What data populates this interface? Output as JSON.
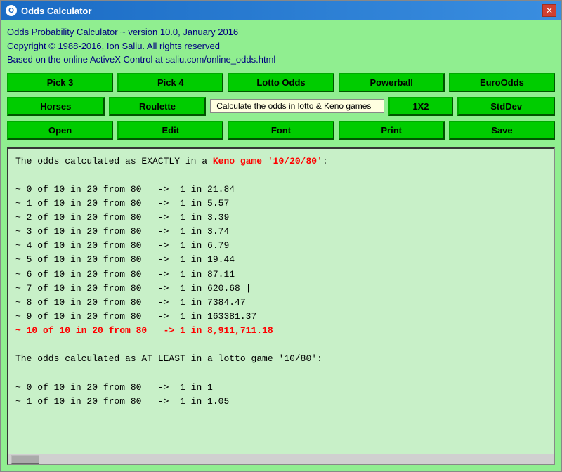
{
  "window": {
    "title": "Odds Calculator",
    "icon": "O"
  },
  "header": {
    "line1": "Odds Probability Calculator ~ version 10.0, January 2016",
    "line2": "Copyright © 1988-2016, Ion Saliu. All rights reserved",
    "line3": "Based on the online ActiveX Control at saliu.com/online_odds.html"
  },
  "buttons_row1": {
    "btn1": "Pick 3",
    "btn2": "Pick 4",
    "btn3": "Lotto Odds",
    "btn4": "Powerball",
    "btn5": "EuroOdds"
  },
  "buttons_row2": {
    "btn1": "Horses",
    "btn2": "Roulette",
    "tooltip": "Calculate the odds in lotto & Keno games",
    "btn3": "1X2",
    "btn4": "StdDev"
  },
  "buttons_row3": {
    "btn1": "Open",
    "btn2": "Edit",
    "btn3": "Font",
    "btn4": "Print",
    "btn5": "Save"
  },
  "output": {
    "lines": [
      {
        "text": "The odds calculated as EXACTLY in a ",
        "type": "normal"
      },
      {
        "text": "Keno game '10/20/80':",
        "type": "red-inline",
        "prefix": "The odds calculated as EXACTLY in a "
      },
      {
        "text": "",
        "type": "blank"
      },
      {
        "text": "~ 0 of 10 in 20 from 80   ->  1 in 21.84",
        "type": "normal"
      },
      {
        "text": "~ 1 of 10 in 20 from 80   ->  1 in 5.57",
        "type": "normal"
      },
      {
        "text": "~ 2 of 10 in 20 from 80   ->  1 in 3.39",
        "type": "normal"
      },
      {
        "text": "~ 3 of 10 in 20 from 80   ->  1 in 3.74",
        "type": "normal"
      },
      {
        "text": "~ 4 of 10 in 20 from 80   ->  1 in 6.79",
        "type": "normal"
      },
      {
        "text": "~ 5 of 10 in 20 from 80   ->  1 in 19.44",
        "type": "normal"
      },
      {
        "text": "~ 6 of 10 in 20 from 80   ->  1 in 87.11",
        "type": "normal"
      },
      {
        "text": "~ 7 of 10 in 20 from 80   ->  1 in 620.68 |",
        "type": "normal"
      },
      {
        "text": "~ 8 of 10 in 20 from 80   ->  1 in 7384.47",
        "type": "normal"
      },
      {
        "text": "~ 9 of 10 in 20 from 80   ->  1 in 163381.37",
        "type": "normal"
      },
      {
        "text": "~ 10 of 10 in 20 from 80   ->  1 in 8,911,711.18",
        "type": "red"
      },
      {
        "text": "",
        "type": "blank"
      },
      {
        "text": "The odds calculated as AT LEAST in a lotto game '10/80':",
        "type": "normal"
      },
      {
        "text": "",
        "type": "blank"
      },
      {
        "text": "~ 0 of 10 in 20 from 80   ->  1 in 1",
        "type": "normal"
      },
      {
        "text": "~ 1 of 10 in 20 from 80   ->  1 in 1.05",
        "type": "normal"
      }
    ]
  }
}
